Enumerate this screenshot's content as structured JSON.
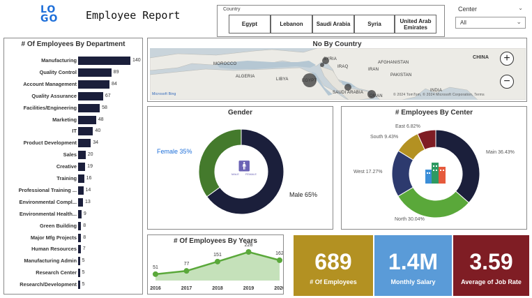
{
  "header": {
    "logo_text": "LOGO",
    "title": "Employee Report"
  },
  "country_slicer": {
    "label": "Country",
    "options": [
      "Egypt",
      "Lebanon",
      "Saudi Arabia",
      "Syria",
      "United Arab Emirates"
    ]
  },
  "center_dropdown": {
    "label": "Center",
    "selected": "All"
  },
  "dept_chart": {
    "title": "# Of Employees By Department",
    "bar_color": "#1b1f3b"
  },
  "map": {
    "title": "No By Country",
    "labels": [
      "MOROCCO",
      "ALGERIA",
      "LIBYA",
      "EGYPT",
      "SYRIA",
      "IRAQ",
      "AFGHANISTAN",
      "IRAN",
      "PAKISTAN",
      "SAUDI ARABIA",
      "OMAN",
      "INDIA",
      "CHINA"
    ],
    "attribution_left": "Microsoft Bing",
    "attribution_right": "© 2024 TomTom, © 2024 Microsoft Corporation, Terms",
    "zoom_in": "+",
    "zoom_out": "−"
  },
  "gender": {
    "title": "Gender",
    "female_label": "Female 35%",
    "male_label": "Male 65%",
    "icon_text_left": "MALE",
    "icon_text_right": "FEMALE"
  },
  "center_chart": {
    "title": "# Employees By Center",
    "labels": [
      "Main 36.43%",
      "North 30.04%",
      "West 17.27%",
      "South 9.43%",
      "East 6.82%"
    ]
  },
  "years": {
    "title": "# Of Employees By Years"
  },
  "kpis": [
    {
      "value": "689",
      "label": "# Of Employees",
      "color": "#b39122"
    },
    {
      "value": "1.4M",
      "label": "Monthly Salary",
      "color": "#5a9bd8"
    },
    {
      "value": "3.59",
      "label": "Average of Job Rate",
      "color": "#7f1d24"
    }
  ],
  "chart_data": [
    {
      "type": "bar",
      "title": "# Of Employees By Department",
      "categories": [
        "Manufacturing",
        "Quality Control",
        "Account Management",
        "Quality Assurance",
        "Facilities/Engineering",
        "Marketing",
        "IT",
        "Product Development",
        "Sales",
        "Creative",
        "Training",
        "Professional Training ...",
        "Environmental Compl...",
        "Environmental Health...",
        "Green Building",
        "Major Mfg Projects",
        "Human Resources",
        "Manufacturing Admin",
        "Research Center",
        "Research/Development"
      ],
      "values": [
        140,
        89,
        84,
        67,
        58,
        48,
        40,
        34,
        20,
        19,
        16,
        14,
        13,
        9,
        8,
        8,
        7,
        5,
        5,
        5
      ],
      "orientation": "horizontal"
    },
    {
      "type": "pie",
      "title": "Gender",
      "categories": [
        "Female",
        "Male"
      ],
      "values": [
        35,
        65
      ],
      "colors": [
        "#447a2c",
        "#1b1f3b"
      ]
    },
    {
      "type": "pie",
      "title": "# Employees By Center",
      "categories": [
        "Main",
        "North",
        "West",
        "South",
        "East"
      ],
      "values": [
        36.43,
        30.04,
        17.27,
        9.43,
        6.82
      ],
      "colors": [
        "#1b1f3b",
        "#5aa83a",
        "#2d3a6e",
        "#b39122",
        "#7f1d24"
      ]
    },
    {
      "type": "area",
      "title": "# Of Employees By Years",
      "x": [
        "2016",
        "2017",
        "2018",
        "2019",
        "2020"
      ],
      "values": [
        51,
        77,
        151,
        228,
        162
      ],
      "color": "#5aa83a"
    }
  ]
}
